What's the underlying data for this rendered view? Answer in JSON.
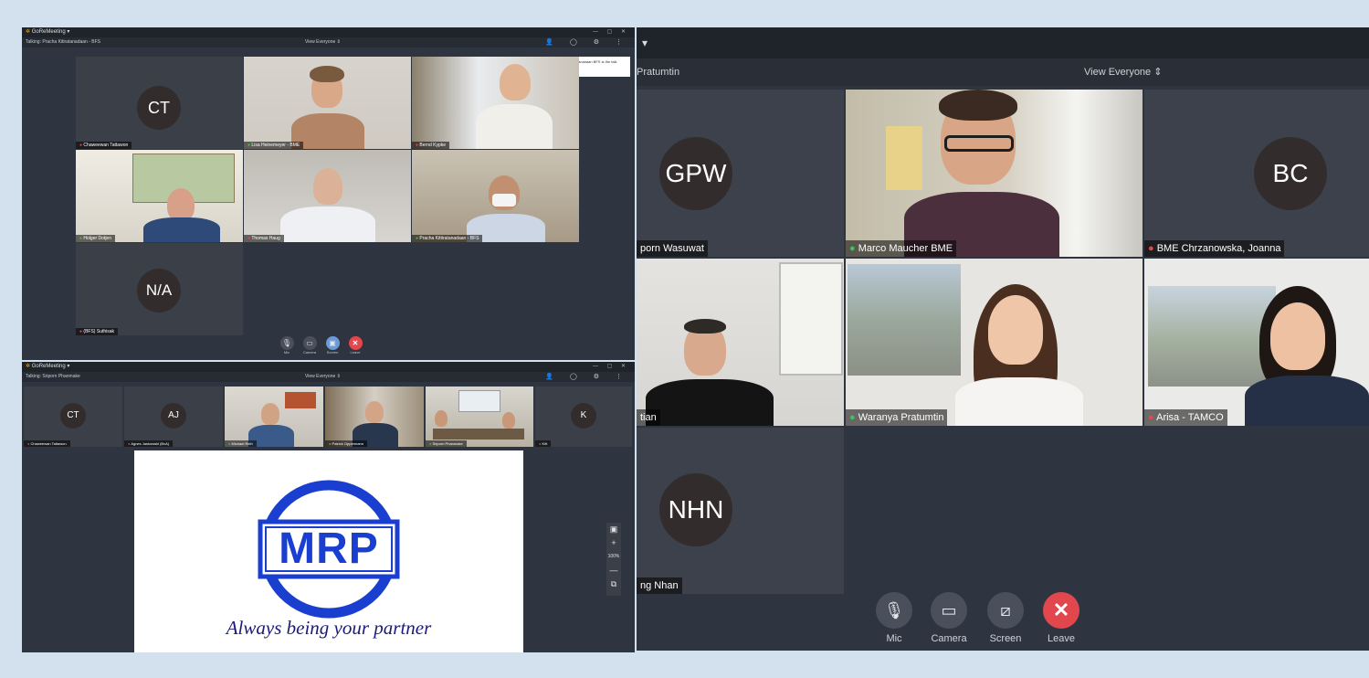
{
  "window1": {
    "app_title": "GoReMeeting",
    "talking": "Talking: Pracha Kitiratanadaan - BFS",
    "view": "View Everyone",
    "notification": "Pracha Kitiratanadaan BFS is the talk presenter",
    "participants": [
      {
        "initials": "CT",
        "name": "Chaweewan Tattawon",
        "mic": "off"
      },
      {
        "initials": "",
        "name": "Lisa Heinemeyer - BME",
        "mic": "on"
      },
      {
        "initials": "",
        "name": "Bernd Kypke",
        "mic": "off"
      },
      {
        "initials": "",
        "name": "Holger Dotjen",
        "mic": "on"
      },
      {
        "initials": "",
        "name": "Thomas Haug",
        "mic": "off"
      },
      {
        "initials": "",
        "name": "Pracha Kittiratanadaan - BFS",
        "mic": "on"
      },
      {
        "initials": "N/A",
        "name": "(BFS) Suthisak",
        "mic": "off"
      }
    ],
    "controls": [
      "Mic",
      "Camera",
      "Screen",
      "Leave"
    ]
  },
  "window2": {
    "app_title": "GoReMeeting",
    "talking": "Talking: Sriporn Phanmake",
    "view": "View Everyone",
    "participants": [
      {
        "initials": "CT",
        "name": "Chaweewan Tattawon",
        "mic": "off"
      },
      {
        "initials": "AJ",
        "name": "Agnes Jaskowski (BvA)",
        "mic": "off"
      },
      {
        "initials": "",
        "name": "Michael Reih",
        "mic": "on"
      },
      {
        "initials": "",
        "name": "Patrick Oppermann",
        "mic": "on"
      },
      {
        "initials": "",
        "name": "Sriporn Phanmake",
        "mic": "on"
      },
      {
        "initials": "K",
        "name": "Kitt",
        "mic": "off"
      }
    ],
    "shared_logo": "MRP",
    "tagline": "Always being your partner",
    "zoom_level": "100%"
  },
  "window3": {
    "talking_fragment": "Pratumtin",
    "view": "View Everyone",
    "participants": [
      {
        "initials": "GPW",
        "name": "porn Wasuwat",
        "mic": "none"
      },
      {
        "initials": "",
        "name": "Marco Maucher BME",
        "mic": "on"
      },
      {
        "initials": "BC",
        "name": "BME Chrzanowska, Joanna",
        "mic": "off"
      },
      {
        "initials": "",
        "name": "tian",
        "mic": "none"
      },
      {
        "initials": "",
        "name": "Waranya Pratumtin",
        "mic": "on"
      },
      {
        "initials": "",
        "name": "Arisa - TAMCO",
        "mic": "off"
      },
      {
        "initials": "NHN",
        "name": "ng Nhan",
        "mic": "none"
      }
    ],
    "controls": [
      "Mic",
      "Camera",
      "Screen",
      "Leave"
    ]
  },
  "colors": {
    "accent_green": "#3fbf5f",
    "accent_red": "#e2474d",
    "panel": "#2e3440"
  }
}
